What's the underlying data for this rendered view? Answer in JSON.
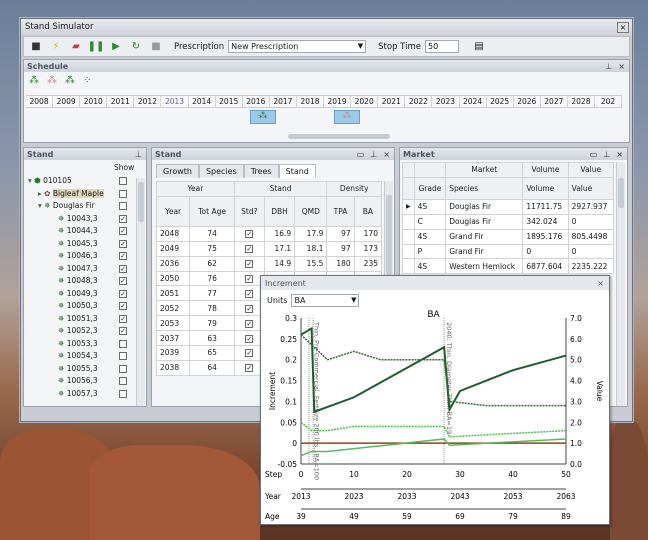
{
  "window_title": "Stand Simulator",
  "close_glyph": "×",
  "toolbar": {
    "prescription_label": "Prescription",
    "prescription_value": "New Prescription",
    "stop_label": "Stop Time",
    "stop_value": "50"
  },
  "schedule": {
    "title": "Schedule",
    "years": [
      "2008",
      "2009",
      "2010",
      "2011",
      "2012",
      "2013",
      "2014",
      "2015",
      "2016",
      "2017",
      "2018",
      "2019",
      "2020",
      "2021",
      "2022",
      "2023",
      "2024",
      "2025",
      "2026",
      "2027",
      "2028",
      "202"
    ]
  },
  "stand_tree": {
    "title": "Stand",
    "show_label": "Show",
    "root": "010105",
    "species": [
      "Bigleaf Maple",
      "Douglas Fir"
    ],
    "items": [
      "10043,3",
      "10044,3",
      "10045,3",
      "10046,3",
      "10047,3",
      "10048,3",
      "10049,3",
      "10050,3",
      "10051,3",
      "10052,3",
      "10053,3",
      "10054,3",
      "10055,3",
      "10056,3",
      "10057,3"
    ],
    "checked": [
      true,
      true,
      true,
      true,
      true,
      true,
      true,
      true,
      true,
      true,
      false,
      false,
      false,
      false,
      false
    ]
  },
  "stand_table": {
    "title": "Stand",
    "tabs": [
      "Growth",
      "Species",
      "Trees",
      "Stand"
    ],
    "group_year": "Year",
    "group_stand": "Stand",
    "group_density": "Density",
    "cols": [
      "Year",
      "Tot Age",
      "Std?",
      "DBH",
      "QMD",
      "TPA",
      "BA"
    ],
    "rows": [
      [
        "2048",
        "74",
        "16.9",
        "17.9",
        "97",
        "170"
      ],
      [
        "2049",
        "75",
        "17.1",
        "18.1",
        "97",
        "173"
      ],
      [
        "2036",
        "62",
        "14.9",
        "15.5",
        "180",
        "235"
      ],
      [
        "2050",
        "76",
        "17.3",
        "18.3",
        "97",
        "177"
      ],
      [
        "2051",
        "77",
        "",
        "",
        "",
        "",
        ""
      ],
      [
        "2052",
        "78",
        "",
        "",
        "",
        "",
        ""
      ],
      [
        "2053",
        "79",
        "",
        "",
        "",
        "",
        ""
      ],
      [
        "2037",
        "63",
        "",
        "",
        "",
        "",
        ""
      ],
      [
        "2039",
        "65",
        "",
        "",
        "",
        "",
        ""
      ],
      [
        "2038",
        "64",
        "",
        "",
        "",
        "",
        ""
      ]
    ]
  },
  "market": {
    "title": "Market",
    "group_market": "Market",
    "group_volume": "Volume",
    "group_value": "Value",
    "cols": [
      "Grade",
      "Species",
      "Volume",
      "Value"
    ],
    "rows": [
      [
        "4S",
        "Douglas Fir",
        "11711.75",
        "2927.937"
      ],
      [
        "C",
        "Douglas Fir",
        "342.024",
        "0"
      ],
      [
        "4S",
        "Grand Fir",
        "1895.176",
        "805.4498"
      ],
      [
        "P",
        "Grand Fir",
        "0",
        "0"
      ],
      [
        "4S",
        "Western Hemlock",
        "6877.604",
        "2235.222"
      ]
    ]
  },
  "increment": {
    "title": "Increment",
    "units_label": "Units",
    "units_value": "BA",
    "chart_title": "BA",
    "left_axis": "Increment",
    "right_axis": "Value",
    "left_ticks": [
      "0.3",
      "0.25",
      "0.2",
      "0.15",
      "0.1",
      "0.05",
      "0",
      "-0.05"
    ],
    "right_ticks": [
      "7.0",
      "6.0",
      "5.0",
      "4.0",
      "3.0",
      "2.0",
      "1.0",
      "0.0"
    ],
    "step_label": "Step",
    "year_label": "Year",
    "age_label": "Age",
    "steps": [
      "0",
      "10",
      "20",
      "30",
      "40",
      "50"
    ],
    "year_ticks": [
      "2013",
      "2023",
      "2033",
      "2043",
      "2053",
      "2063"
    ],
    "age_ticks": [
      "39",
      "49",
      "59",
      "69",
      "79",
      "89"
    ],
    "annotations": [
      "Thin, Pre-Commercial, Fertilize 200 lbs...BA=100",
      "2040: Thin, Diameter Thin, BA=19"
    ]
  },
  "chart_data": {
    "type": "line",
    "title": "BA",
    "xlabel": "Step",
    "ylabel": "Increment",
    "y2label": "Value",
    "xlim": [
      0,
      50
    ],
    "ylim": [
      -0.05,
      0.3
    ],
    "y2lim": [
      0,
      7
    ],
    "series": [
      {
        "values_x": [
          0,
          2,
          2.5,
          10,
          27,
          28,
          30,
          40,
          50
        ],
        "values_y": [
          6.2,
          6.5,
          2.5,
          3.2,
          5.6,
          2.6,
          3.5,
          4.5,
          5.2
        ],
        "axis": "right",
        "color": "#1e5c2a"
      },
      {
        "values_x": [
          0,
          5,
          10,
          15,
          20,
          27,
          28,
          35,
          50
        ],
        "values_y": [
          0.26,
          0.2,
          0.22,
          0.2,
          0.2,
          0.2,
          0.1,
          0.09,
          0.09
        ],
        "axis": "left",
        "color": "#2e6b2e"
      },
      {
        "values_x": [
          0,
          2,
          5,
          10,
          20,
          27,
          28,
          35,
          50
        ],
        "values_y": [
          0.05,
          0.03,
          0.03,
          0.04,
          0.04,
          0.04,
          0.015,
          0.02,
          0.03
        ],
        "axis": "left",
        "color": "#4cbf4c"
      },
      {
        "values_x": [
          0,
          5,
          10,
          20,
          27,
          28,
          35,
          50
        ],
        "values_y": [
          0.0,
          0.0,
          0.0,
          0.0,
          0.0,
          0.0,
          0.0,
          0.0
        ],
        "axis": "left",
        "color": "#8b4513"
      },
      {
        "values_x": [
          0,
          2,
          5,
          27,
          28,
          50
        ],
        "values_y": [
          0.4,
          0.6,
          0.6,
          1.2,
          0.9,
          1.2
        ],
        "axis": "right",
        "color": "#5ab85a"
      }
    ]
  }
}
